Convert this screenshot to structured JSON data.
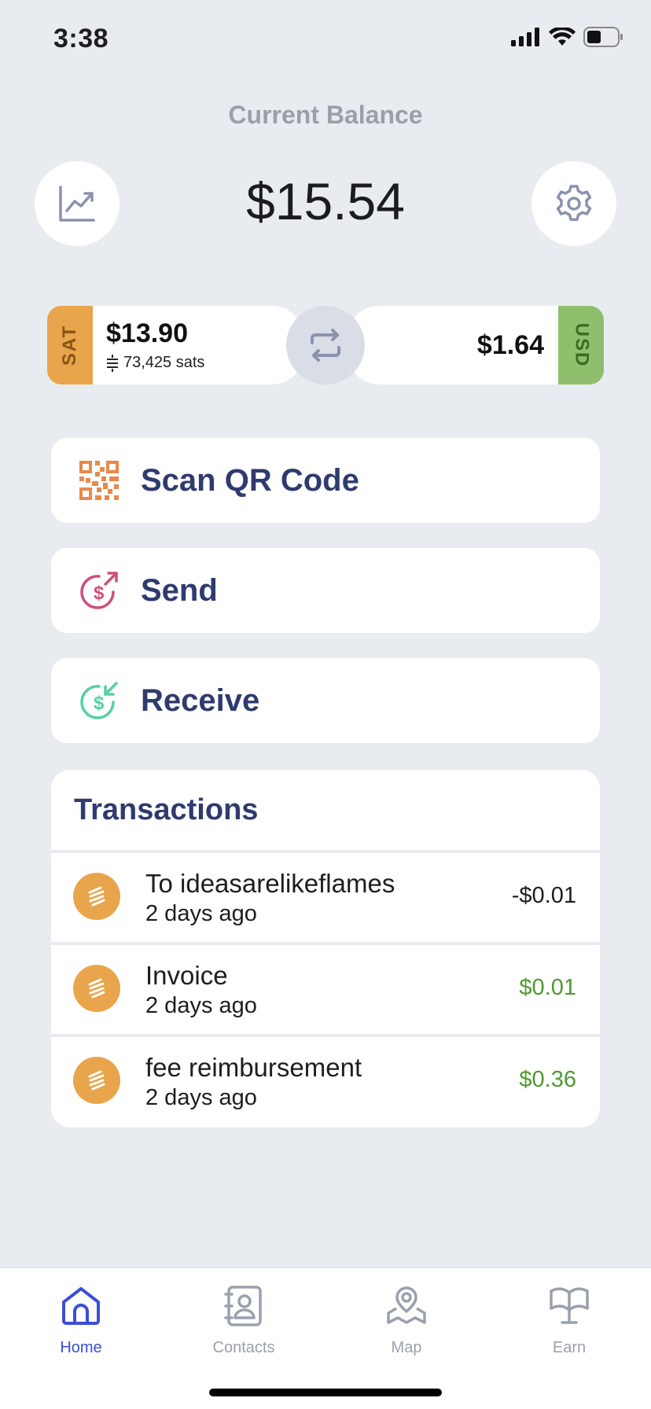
{
  "status": {
    "time": "3:38"
  },
  "balance": {
    "label": "Current Balance",
    "value": "$15.54"
  },
  "wallets": {
    "sat": {
      "tag": "SAT",
      "amount": "$13.90",
      "sats": "73,425 sats"
    },
    "usd": {
      "tag": "USD",
      "amount": "$1.64"
    }
  },
  "actions": {
    "scan": "Scan QR Code",
    "send": "Send",
    "receive": "Receive"
  },
  "transactions": {
    "title": "Transactions",
    "items": [
      {
        "name": "To ideasarelikeflames",
        "date": "2 days ago",
        "amount": "-$0.01"
      },
      {
        "name": "Invoice",
        "date": "2 days ago",
        "amount": "$0.01"
      },
      {
        "name": "fee reimbursement",
        "date": "2 days ago",
        "amount": "$0.36"
      }
    ]
  },
  "tabs": {
    "home": "Home",
    "contacts": "Contacts",
    "map": "Map",
    "earn": "Earn"
  },
  "colors": {
    "accent": "#3b4fd6",
    "sat": "#e8a54b",
    "usd": "#8fbf6c",
    "positive": "#4f9a2e",
    "title": "#2f3b6e"
  },
  "icons": [
    "chart-icon",
    "gear-icon",
    "swap-icon",
    "qr-code-icon",
    "send-money-icon",
    "receive-money-icon",
    "bitcoin-icon",
    "home-icon",
    "contacts-icon",
    "map-icon",
    "earn-icon"
  ]
}
